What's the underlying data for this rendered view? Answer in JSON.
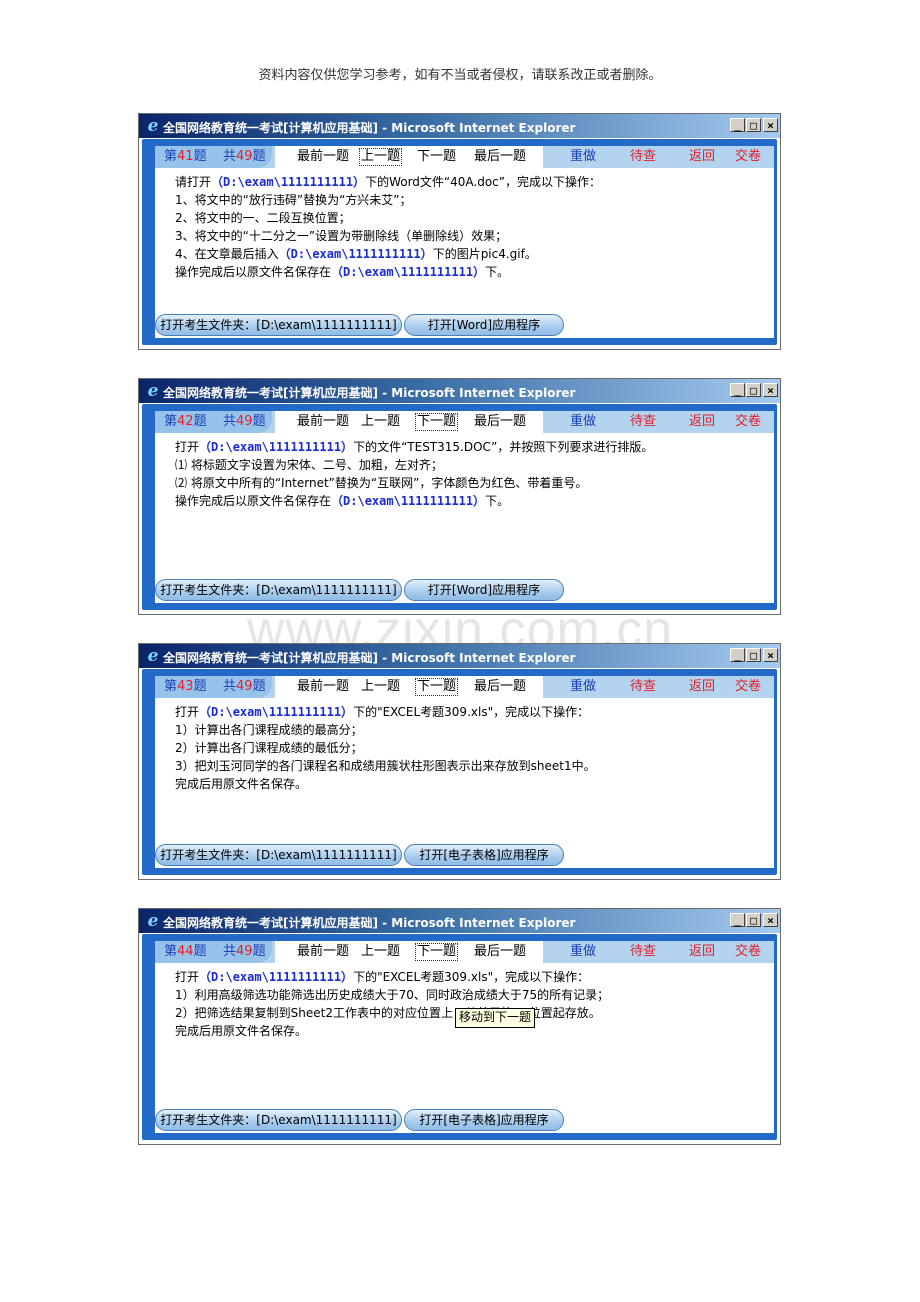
{
  "page_note": "资料内容仅供您学习参考，如有不当或者侵权，请联系改正或者删除。",
  "watermark": "www.zixin.com.cn",
  "window_title": "全国网络教育统一考试[计算机应用基础] - Microsoft Internet Explorer",
  "nav": {
    "q_prefix": "第",
    "q_suffix": "题",
    "total_prefix": "共",
    "total": "49",
    "total_suffix": "题",
    "first": "最前一题",
    "prev": "上一题",
    "next": "下一题",
    "last": "最后一题",
    "redo": "重做",
    "review": "待查",
    "back": "返回",
    "submit": "交卷"
  },
  "windows": [
    {
      "q_num": "41",
      "focused": "prev",
      "lines": [
        {
          "pre": "请打开",
          "path": "（D:\\exam\\1111111111）",
          "post": "下的Word文件“40A.doc”，完成以下操作："
        },
        {
          "pre": "1、将文中的“放行违碍”替换为“方兴未艾”；",
          "path": "",
          "post": ""
        },
        {
          "pre": "2、将文中的一、二段互换位置；",
          "path": "",
          "post": ""
        },
        {
          "pre": "3、将文中的“十二分之一”设置为带删除线（单删除线）效果；",
          "path": "",
          "post": ""
        },
        {
          "pre": "4、在文章最后插入",
          "path": "（D:\\exam\\1111111111）",
          "post": "下的图片pic4.gif。"
        },
        {
          "pre": "操作完成后以原文件名保存在",
          "path": "（D:\\exam\\1111111111）",
          "post": "下。"
        }
      ],
      "btn_folder": "打开考生文件夹：[D:\\exam\\1111111111]",
      "btn_app": "打开[Word]应用程序"
    },
    {
      "q_num": "42",
      "focused": "next",
      "lines": [
        {
          "pre": "打开",
          "path": "（D:\\exam\\1111111111）",
          "post": "下的文件“TEST315.DOC”，并按照下列要求进行排版。"
        },
        {
          "pre": "⑴ 将标题文字设置为宋体、二号、加粗，左对齐；",
          "path": "",
          "post": ""
        },
        {
          "pre": "⑵ 将原文中所有的“Internet”替换为“互联网”，字体颜色为红色、带着重号。",
          "path": "",
          "post": ""
        },
        {
          "pre": "操作完成后以原文件名保存在",
          "path": "（D:\\exam\\1111111111）",
          "post": "下。"
        }
      ],
      "btn_folder": "打开考生文件夹：[D:\\exam\\1111111111]",
      "btn_app": "打开[Word]应用程序"
    },
    {
      "q_num": "43",
      "focused": "next",
      "lines": [
        {
          "pre": "打开",
          "path": "（D:\\exam\\1111111111）",
          "post": "下的\"EXCEL考题309.xls\"，完成以下操作："
        },
        {
          "pre": "1）计算出各门课程成绩的最高分；",
          "path": "",
          "post": ""
        },
        {
          "pre": "2）计算出各门课程成绩的最低分；",
          "path": "",
          "post": ""
        },
        {
          "pre": "3）把刘玉河同学的各门课程名和成绩用簇状柱形图表示出来存放到sheet1中。",
          "path": "",
          "post": ""
        },
        {
          "pre": "完成后用原文件名保存。",
          "path": "",
          "post": ""
        }
      ],
      "btn_folder": "打开考生文件夹：[D:\\exam\\1111111111]",
      "btn_app": "打开[电子表格]应用程序"
    },
    {
      "q_num": "44",
      "focused": "next",
      "tooltip": "移动到下一题",
      "lines": [
        {
          "pre": "打开",
          "path": "（D:\\exam\\1111111111）",
          "post": "下的\"EXCEL考题309.xls\"，完成以下操作："
        },
        {
          "pre": "1）利用高级筛选功能筛选出历史成绩大于70、同时政治成绩大于75的所有记录；",
          "path": "",
          "post": ""
        },
        {
          "pre": "2）把筛选结果复制到Sheet2工作表中的对应位置上，从单元格A1位置起存放。",
          "path": "",
          "post": ""
        },
        {
          "pre": "完成后用原文件名保存。",
          "path": "",
          "post": ""
        }
      ],
      "btn_folder": "打开考生文件夹：[D:\\exam\\1111111111]",
      "btn_app": "打开[电子表格]应用程序"
    }
  ]
}
